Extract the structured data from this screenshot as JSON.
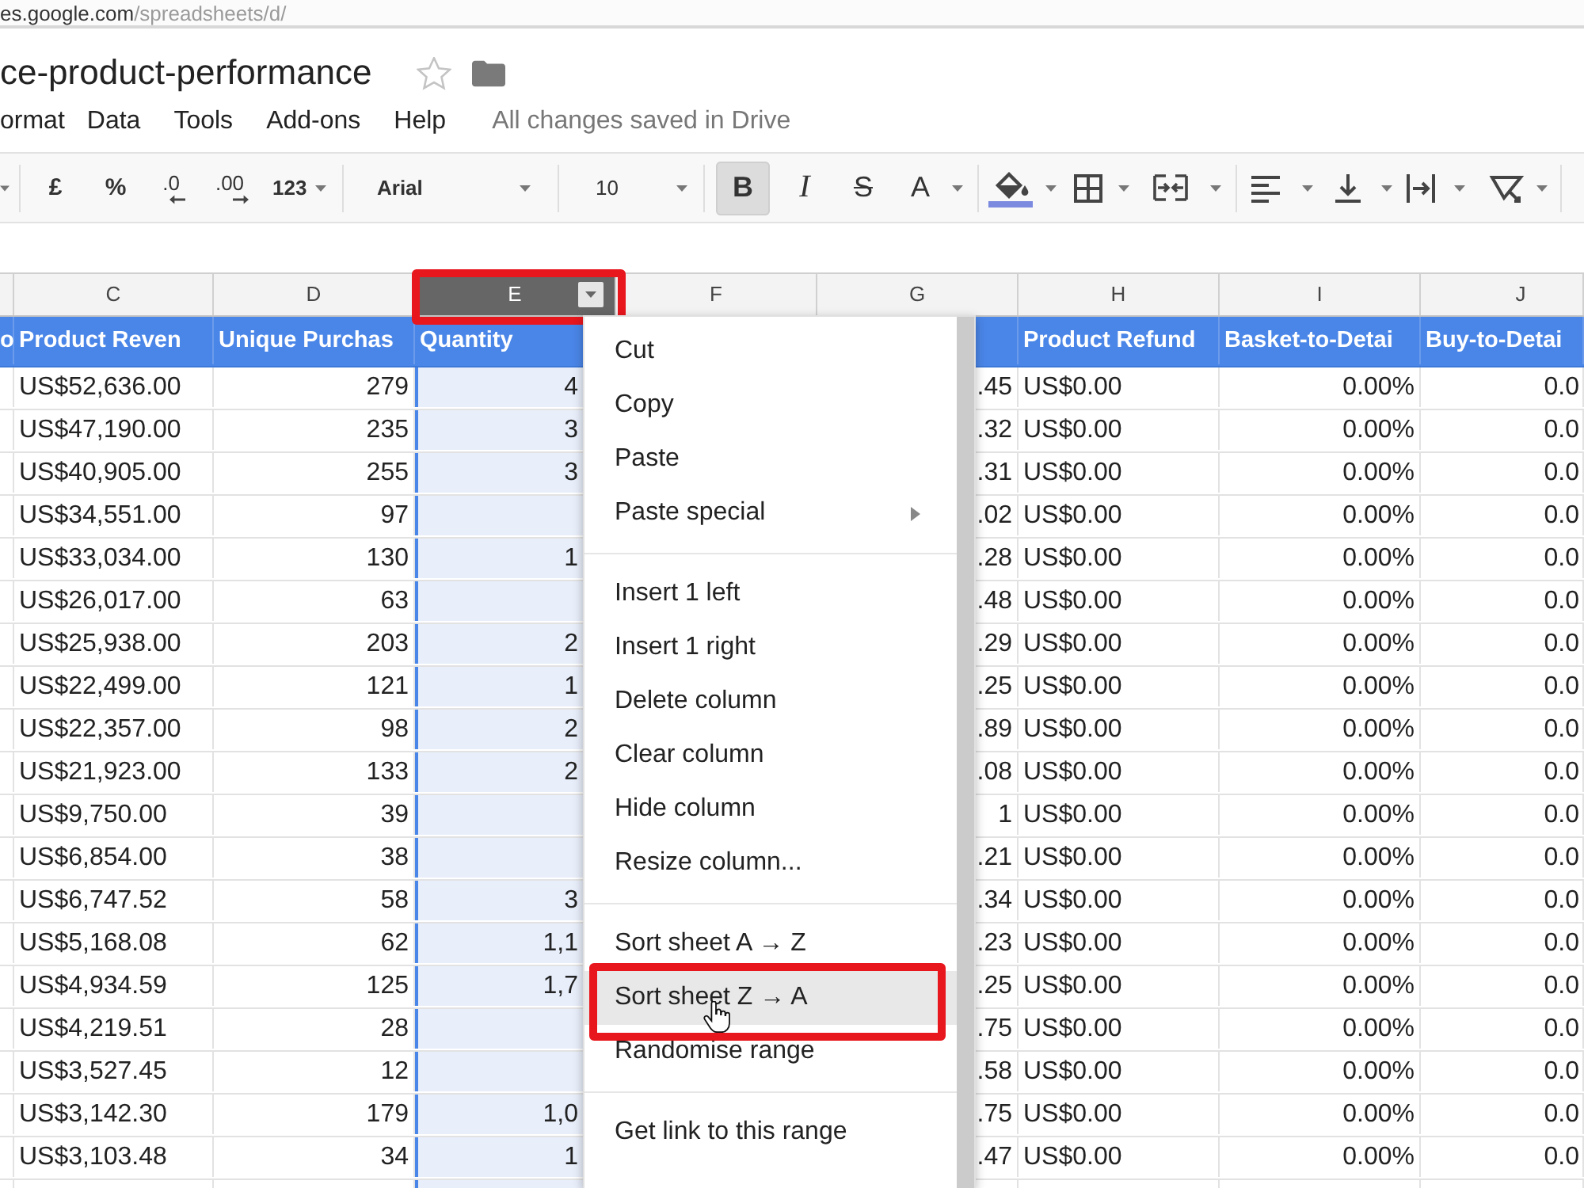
{
  "browser": {
    "url_host": "es.google.com",
    "url_path": "/spreadsheets/d/"
  },
  "document": {
    "title": "ce-product-performance",
    "starred": false
  },
  "menubar": {
    "items": [
      "ormat",
      "Data",
      "Tools",
      "Add-ons",
      "Help"
    ],
    "save_status": "All changes saved in Drive"
  },
  "toolbar": {
    "number_buttons": [
      "£",
      "%",
      ".0",
      ".00"
    ],
    "number_format": "123",
    "font": "Arial",
    "font_size": "10",
    "style_buttons": [
      {
        "label": "B",
        "selected": true
      },
      {
        "label": "I",
        "selected": false
      },
      {
        "label": "S",
        "selected": false
      },
      {
        "label": "A",
        "selected": false
      }
    ]
  },
  "sheet": {
    "columns": [
      {
        "heading": "o",
        "selected": false,
        "outlined": false
      },
      {
        "letter": "C",
        "kind": "currency",
        "heading": "Product Reven",
        "selected": false,
        "outlined": false
      },
      {
        "letter": "D",
        "kind": "number",
        "heading": "Unique Purchas",
        "selected": false,
        "outlined": false
      },
      {
        "letter": "E",
        "kind": "number",
        "heading": "Quantity",
        "selected": true,
        "outlined": true
      },
      {
        "letter": "F",
        "selected": false,
        "outlined": false
      },
      {
        "letter": "G",
        "kind": "number",
        "selected": false,
        "outlined": false
      },
      {
        "letter": "H",
        "kind": "currency",
        "heading": "Product Refund",
        "selected": false,
        "outlined": false
      },
      {
        "letter": "I",
        "kind": "percent",
        "heading": "Basket-to-Detai",
        "selected": false,
        "outlined": false
      },
      {
        "letter": "J",
        "kind": "percent",
        "heading": "Buy-to-Detai",
        "selected": false,
        "outlined": false
      }
    ],
    "rows": [
      {
        "C": "US$52,636.00",
        "D": "279",
        "E": "4",
        "G": ".45",
        "H": "US$0.00",
        "I": "0.00%",
        "J": "0.0"
      },
      {
        "C": "US$47,190.00",
        "D": "235",
        "E": "3",
        "G": ".32",
        "H": "US$0.00",
        "I": "0.00%",
        "J": "0.0"
      },
      {
        "C": "US$40,905.00",
        "D": "255",
        "E": "3",
        "G": ".31",
        "H": "US$0.00",
        "I": "0.00%",
        "J": "0.0"
      },
      {
        "C": "US$34,551.00",
        "D": "97",
        "G": ".02",
        "H": "US$0.00",
        "I": "0.00%",
        "J": "0.0"
      },
      {
        "C": "US$33,034.00",
        "D": "130",
        "E": "1",
        "G": ".28",
        "H": "US$0.00",
        "I": "0.00%",
        "J": "0.0"
      },
      {
        "C": "US$26,017.00",
        "D": "63",
        "G": ".48",
        "H": "US$0.00",
        "I": "0.00%",
        "J": "0.0"
      },
      {
        "C": "US$25,938.00",
        "D": "203",
        "E": "2",
        "G": ".29",
        "H": "US$0.00",
        "I": "0.00%",
        "J": "0.0"
      },
      {
        "C": "US$22,499.00",
        "D": "121",
        "E": "1",
        "G": ".25",
        "H": "US$0.00",
        "I": "0.00%",
        "J": "0.0"
      },
      {
        "C": "US$22,357.00",
        "D": "98",
        "E": "2",
        "G": ".89",
        "H": "US$0.00",
        "I": "0.00%",
        "J": "0.0"
      },
      {
        "C": "US$21,923.00",
        "D": "133",
        "E": "2",
        "G": ".08",
        "H": "US$0.00",
        "I": "0.00%",
        "J": "0.0"
      },
      {
        "C": "US$9,750.00",
        "D": "39",
        "G": "1",
        "H": "US$0.00",
        "I": "0.00%",
        "J": "0.0"
      },
      {
        "C": "US$6,854.00",
        "D": "38",
        "G": ".21",
        "H": "US$0.00",
        "I": "0.00%",
        "J": "0.0"
      },
      {
        "C": "US$6,747.52",
        "D": "58",
        "E": "3",
        "G": ".34",
        "H": "US$0.00",
        "I": "0.00%",
        "J": "0.0"
      },
      {
        "C": "US$5,168.08",
        "D": "62",
        "E": "1,1",
        "G": ".23",
        "H": "US$0.00",
        "I": "0.00%",
        "J": "0.0"
      },
      {
        "C": "US$4,934.59",
        "D": "125",
        "E": "1,7",
        "G": ".25",
        "H": "US$0.00",
        "I": "0.00%",
        "J": "0.0"
      },
      {
        "C": "US$4,219.51",
        "D": "28",
        "G": ".75",
        "H": "US$0.00",
        "I": "0.00%",
        "J": "0.0"
      },
      {
        "C": "US$3,527.45",
        "D": "12",
        "G": ".58",
        "H": "US$0.00",
        "I": "0.00%",
        "J": "0.0"
      },
      {
        "C": "US$3,142.30",
        "D": "179",
        "E": "1,0",
        "G": ".75",
        "H": "US$0.00",
        "I": "0.00%",
        "J": "0.0"
      },
      {
        "C": "US$3,103.48",
        "D": "34",
        "E": "1",
        "G": ".47",
        "H": "US$0.00",
        "I": "0.00%",
        "J": "0.0"
      }
    ]
  },
  "context_menu": {
    "sections": [
      {
        "items": [
          {
            "label": "Cut",
            "submenu": false,
            "hovered": false,
            "outlined": false
          },
          {
            "label": "Copy",
            "submenu": false,
            "hovered": false,
            "outlined": false
          },
          {
            "label": "Paste",
            "submenu": false,
            "hovered": false,
            "outlined": false
          },
          {
            "label": "Paste special",
            "submenu": true,
            "hovered": false,
            "outlined": false
          }
        ]
      },
      {
        "items": [
          {
            "label": "Insert 1 left",
            "submenu": false,
            "hovered": false,
            "outlined": false
          },
          {
            "label": "Insert 1 right",
            "submenu": false,
            "hovered": false,
            "outlined": false
          },
          {
            "label": "Delete column",
            "submenu": false,
            "hovered": false,
            "outlined": false
          },
          {
            "label": "Clear column",
            "submenu": false,
            "hovered": false,
            "outlined": false
          },
          {
            "label": "Hide column",
            "submenu": false,
            "hovered": false,
            "outlined": false
          },
          {
            "label": "Resize column...",
            "submenu": false,
            "hovered": false,
            "outlined": false
          }
        ]
      },
      {
        "items": [
          {
            "label": "Sort sheet A → Z",
            "submenu": false,
            "hovered": false,
            "outlined": false
          },
          {
            "label": "Sort sheet Z → A",
            "submenu": false,
            "hovered": true,
            "outlined": true
          },
          {
            "label": "Randomise range",
            "submenu": false,
            "hovered": false,
            "outlined": false
          }
        ]
      },
      {
        "items": [
          {
            "label": "Get link to this range",
            "submenu": false,
            "hovered": false,
            "outlined": false
          }
        ]
      }
    ]
  }
}
